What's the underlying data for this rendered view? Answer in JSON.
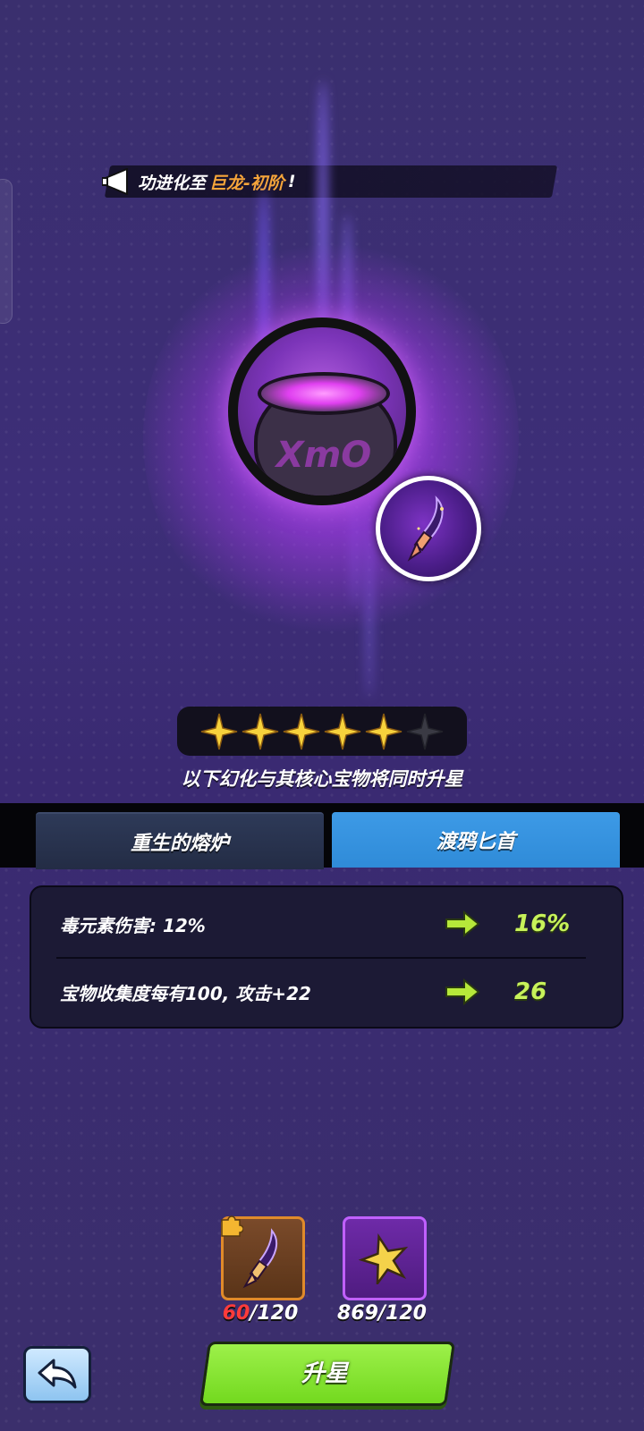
{
  "notice": {
    "prefix": "功进化至",
    "highlight": "巨龙-初阶",
    "suffix": "!"
  },
  "stars": {
    "filled": 5,
    "total": 6
  },
  "subtitle": "以下幻化与其核心宝物将同时升星",
  "tabs": [
    {
      "label": "重生的熔炉",
      "active": false
    },
    {
      "label": "渡鸦匕首",
      "active": true
    }
  ],
  "stats": [
    {
      "label": "毒元素伤害: 12%",
      "value": "16%"
    },
    {
      "label": "宝物收集度每有100, 攻击+22",
      "value": "26"
    }
  ],
  "materials": [
    {
      "icon": "dagger-shard-icon",
      "have": "60",
      "need": "/120",
      "have_color": "#ff3b3b"
    },
    {
      "icon": "star-fragment-icon",
      "have": "869",
      "need": "/120"
    }
  ],
  "pot_inscription": "XmO",
  "buttons": {
    "upgrade_label": "升星"
  },
  "colors": {
    "accent_green": "#c7f25a",
    "tab_active": "#3d9ae6",
    "highlight_orange": "#f6a53a"
  }
}
